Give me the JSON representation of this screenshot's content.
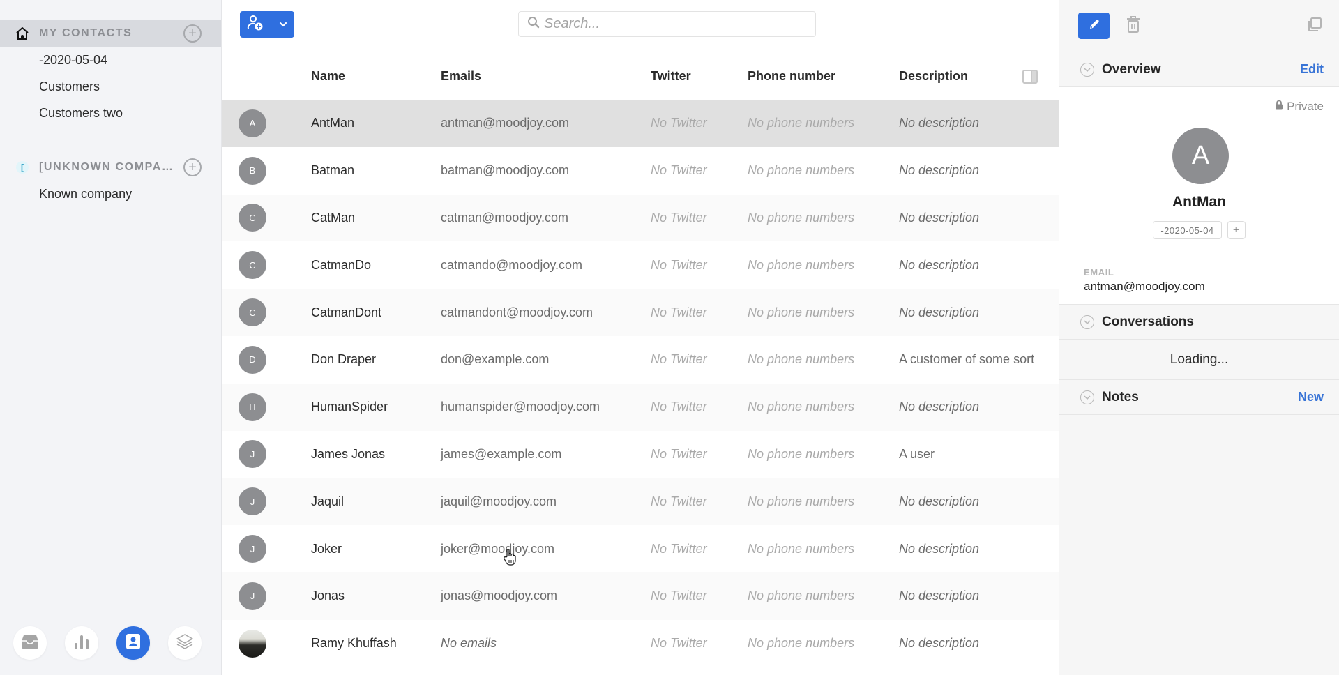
{
  "sidebar": {
    "groups": [
      {
        "title": "MY CONTACTS",
        "icon": "home-icon",
        "items": [
          "-2020-05-04",
          "Customers",
          "Customers two"
        ]
      },
      {
        "title": "[UNKNOWN COMPAN...",
        "icon": "[",
        "items": [
          "Known company"
        ]
      }
    ],
    "bottom_nav": [
      "inbox-icon",
      "stats-icon",
      "contacts-icon",
      "layers-icon"
    ],
    "active_nav": "contacts-icon"
  },
  "toolbar": {
    "search_placeholder": "Search..."
  },
  "table": {
    "columns": [
      "Name",
      "Emails",
      "Twitter",
      "Phone number",
      "Description"
    ],
    "rows": [
      {
        "initial": "A",
        "name": "AntMan",
        "email": "antman@moodjoy.com",
        "twitter": "No Twitter",
        "phone": "No phone numbers",
        "description": "No description",
        "selected": true
      },
      {
        "initial": "B",
        "name": "Batman",
        "email": "batman@moodjoy.com",
        "twitter": "No Twitter",
        "phone": "No phone numbers",
        "description": "No description"
      },
      {
        "initial": "C",
        "name": "CatMan",
        "email": "catman@moodjoy.com",
        "twitter": "No Twitter",
        "phone": "No phone numbers",
        "description": "No description"
      },
      {
        "initial": "C",
        "name": "CatmanDo",
        "email": "catmando@moodjoy.com",
        "twitter": "No Twitter",
        "phone": "No phone numbers",
        "description": "No description"
      },
      {
        "initial": "C",
        "name": "CatmanDont",
        "email": "catmandont@moodjoy.com",
        "twitter": "No Twitter",
        "phone": "No phone numbers",
        "description": "No description"
      },
      {
        "initial": "D",
        "name": "Don Draper",
        "email": "don@example.com",
        "twitter": "No Twitter",
        "phone": "No phone numbers",
        "description": "A customer of some sort"
      },
      {
        "initial": "H",
        "name": "HumanSpider",
        "email": "humanspider@moodjoy.com",
        "twitter": "No Twitter",
        "phone": "No phone numbers",
        "description": "No description"
      },
      {
        "initial": "J",
        "name": "James Jonas",
        "email": "james@example.com",
        "twitter": "No Twitter",
        "phone": "No phone numbers",
        "description": "A user"
      },
      {
        "initial": "J",
        "name": "Jaquil",
        "email": "jaquil@moodjoy.com",
        "twitter": "No Twitter",
        "phone": "No phone numbers",
        "description": "No description"
      },
      {
        "initial": "J",
        "name": "Joker",
        "email": "joker@moodjoy.com",
        "twitter": "No Twitter",
        "phone": "No phone numbers",
        "description": "No description"
      },
      {
        "initial": "J",
        "name": "Jonas",
        "email": "jonas@moodjoy.com",
        "twitter": "No Twitter",
        "phone": "No phone numbers",
        "description": "No description"
      },
      {
        "initial": "",
        "photo": true,
        "name": "Ramy Khuffash",
        "email": "No emails",
        "twitter": "No Twitter",
        "phone": "No phone numbers",
        "description": "No description"
      }
    ],
    "empty_values": [
      "No Twitter",
      "No phone numbers",
      "No description",
      "No emails"
    ]
  },
  "detail": {
    "overview": {
      "title": "Overview",
      "action": "Edit"
    },
    "privacy": "Private",
    "avatar_initial": "A",
    "name": "AntMan",
    "tags": [
      "-2020-05-04"
    ],
    "tag_add_label": "+",
    "email_label": "EMAIL",
    "email": "antman@moodjoy.com",
    "conversations": {
      "title": "Conversations",
      "status": "Loading..."
    },
    "notes": {
      "title": "Notes",
      "action": "New"
    }
  },
  "colors": {
    "accent": "#2f6fdf",
    "link": "#3773d6",
    "selected_row": "#e0e0e0",
    "avatar_bg": "#8d8e91"
  }
}
